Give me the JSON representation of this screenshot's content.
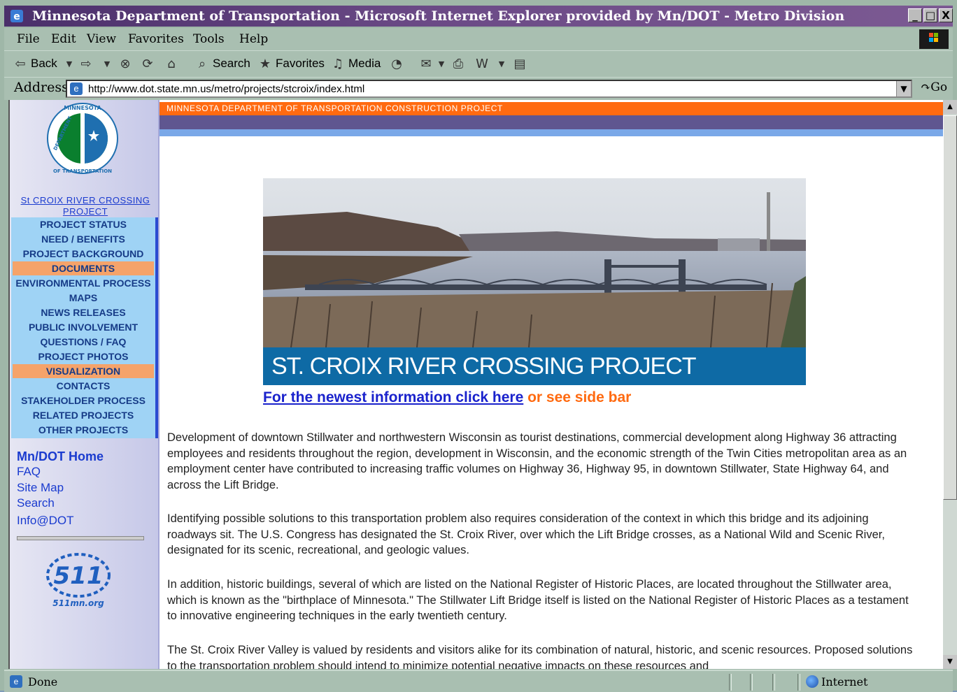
{
  "window": {
    "title": "Minnesota Department of Transportation - Microsoft Internet Explorer provided by Mn/DOT - Metro Division",
    "btn_min": "_",
    "btn_max": "□",
    "btn_close": "X"
  },
  "menu": [
    "File",
    "Edit",
    "View",
    "Favorites",
    "Tools",
    "Help"
  ],
  "toolbar": {
    "back": "Back",
    "search": "Search",
    "favorites": "Favorites",
    "media": "Media"
  },
  "address": {
    "label": "Address",
    "url": "http://www.dot.state.mn.us/metro/projects/stcroix/index.html",
    "go": "Go"
  },
  "page": {
    "banner_text": "MINNESOTA DEPARTMENT OF TRANSPORTATION CONSTRUCTION PROJECT",
    "logo_text_top": "MINNESOTA",
    "logo_text_left": "DEPARTMENT",
    "logo_text_bottom": "OF TRANSPORTATION",
    "sidebar_title": "St CROIX RIVER CROSSING PROJECT",
    "nav": [
      {
        "label": "PROJECT STATUS"
      },
      {
        "label": "NEED / BENEFITS"
      },
      {
        "label": "PROJECT BACKGROUND"
      },
      {
        "label": "DOCUMENTS"
      },
      {
        "label": "ENVIRONMENTAL PROCESS"
      },
      {
        "label": "MAPS"
      },
      {
        "label": "NEWS RELEASES"
      },
      {
        "label": "PUBLIC INVOLVEMENT"
      },
      {
        "label": "QUESTIONS / FAQ"
      },
      {
        "label": "PROJECT PHOTOS"
      },
      {
        "label": "VISUALIZATION"
      },
      {
        "label": "CONTACTS"
      },
      {
        "label": "STAKEHOLDER PROCESS"
      },
      {
        "label": "RELATED PROJECTS"
      },
      {
        "label": "OTHER PROJECTS"
      }
    ],
    "links": {
      "home": "Mn/DOT Home",
      "faq": "FAQ",
      "sitemap": "Site Map",
      "search": "Search",
      "info": "Info@DOT"
    },
    "logo511_number": "511",
    "logo511_url": "511mn.org",
    "hero_caption": "ST. CROIX RIVER CROSSING PROJECT",
    "newest_link": "For the newest information click here",
    "newest_suffix": " or see side bar",
    "paragraphs": [
      "Development of downtown Stillwater and northwestern Wisconsin as tourist destinations, commercial development along Highway 36 attracting employees and residents throughout the region, development in Wisconsin, and the economic strength of the Twin Cities metropolitan area as an employment center have contributed to increasing traffic volumes on Highway 36, Highway 95, in downtown Stillwater, State Highway 64, and across the Lift Bridge.",
      "Identifying possible solutions to this transportation problem also requires consideration of the context in which this bridge and its adjoining roadways sit. The U.S. Congress has designated the St. Croix River, over which the Lift Bridge crosses, as a National Wild and Scenic River, designated for its scenic, recreational, and geologic values.",
      "In addition, historic buildings, several of which are listed on the National Register of Historic Places, are located throughout the Stillwater area, which is known as the \"birthplace of Minnesota.\" The Stillwater Lift Bridge itself is listed on the National Register of Historic Places as a testament to innovative engineering techniques in the early twentieth century.",
      "The St. Croix River Valley is valued by residents and visitors alike for its combination of natural, historic, and scenic resources. Proposed solutions to the transportation problem should intend to minimize potential negative impacts on these resources and"
    ]
  },
  "status": {
    "text": "Done",
    "zone": "Internet"
  }
}
